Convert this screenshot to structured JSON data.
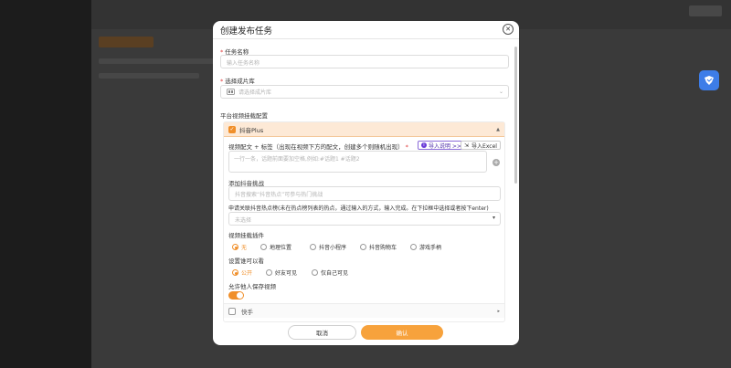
{
  "modal": {
    "title": "创建发布任务",
    "close_symbol": "✕"
  },
  "form": {
    "task_name": {
      "label": "任务名称",
      "placeholder": "输入任务名称"
    },
    "library": {
      "label": "选择成片库",
      "placeholder": "请选择成片库"
    },
    "platform_section": {
      "label": "平台视频挂载配置"
    },
    "douyin": {
      "name": "抖音Plus",
      "caption": {
        "label": "视频配文 + 标签（出现在视频下方的配文，创建多个则随机出现）",
        "guide_link": "导入说明 >>",
        "import_button": "导入Excel",
        "placeholder": "一行一条，话题前面要加空格,例如:#话题1 #话题2"
      },
      "challenge": {
        "label": "添加抖音挑战",
        "placeholder": "抖音搜索“抖音热点”可参与热门挑战"
      },
      "hotspot": {
        "label": "申请关联抖音热点榜(未在热点榜列表的热点，通过输入的方式，输入完成。在下拉框中选择或者按下enter)",
        "placeholder": "未选择"
      },
      "mount": {
        "label": "视频挂载插件",
        "options": [
          "无",
          "地理位置",
          "抖音小程序",
          "抖音购物车",
          "游戏手柄"
        ],
        "selected": "无"
      },
      "visibility": {
        "label": "设置谁可以看",
        "options": [
          "公开",
          "好友可见",
          "仅自己可见"
        ],
        "selected": "公开"
      },
      "allow_save": {
        "label": "允许他人保存视频",
        "enabled": true
      }
    },
    "kuaishou": {
      "name": "快手"
    }
  },
  "footer": {
    "cancel": "取消",
    "confirm": "确认"
  },
  "colors": {
    "accent": "#f08f2a",
    "confirm": "#f7a23c",
    "required": "#e03c3c"
  }
}
